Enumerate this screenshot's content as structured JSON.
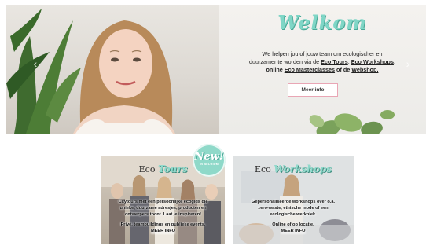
{
  "hero": {
    "title": "Welkom",
    "intro_line1": "We helpen jou of jouw team om ecologischer en",
    "intro_line2_a": "duurzamer te worden via de ",
    "eco_tours": "Eco Tours",
    "comma": ", ",
    "eco_workshops": "Eco Workshops",
    "comma2": ",",
    "intro_line3_a": "online ",
    "eco_masterclasses": "Eco Masterclasses",
    "intro_line3_b": " of de ",
    "webshop": "Webshop.",
    "button_label": "Meer info",
    "prev_arrow": "‹",
    "next_arrow": "›"
  },
  "badge": {
    "main": "New!",
    "sub": "IN BELGIUM"
  },
  "cards": {
    "tours": {
      "title_prefix": "Eco ",
      "title_script": "Tours",
      "line1": "Citytours met een persoonlijke ecogids die",
      "line2": "unieke, duurzame adresjes, producten en",
      "line3": "ontwerpers toont. Laat je inspireren!",
      "line4": "Privé, teambuildings en publieke events.",
      "link": "MEER INFO"
    },
    "workshops": {
      "title_prefix": "Eco ",
      "title_script": "Workshops",
      "line1": "Gepersonaliseerde workshops over o.a.",
      "line2": "zero-waste, ethische mode of een",
      "line3": "ecologische werkplek.",
      "line4": "Online of op locatie.",
      "link": "MEER INFO"
    }
  },
  "colors": {
    "mint": "#8fd9c9",
    "pink_border": "#e9a6b5"
  }
}
